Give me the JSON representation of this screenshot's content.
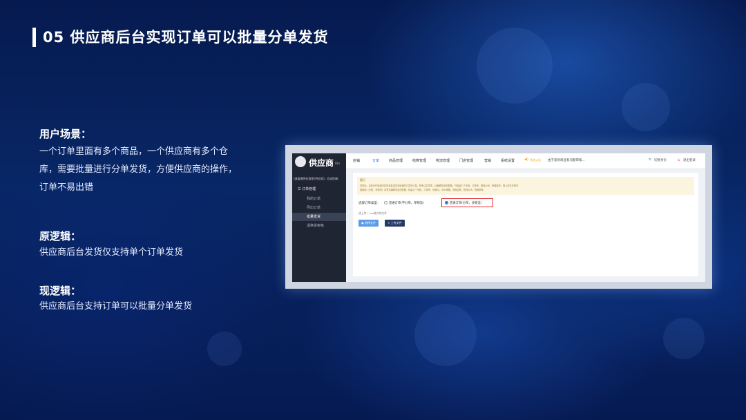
{
  "header": {
    "title": "05 供应商后台实现订单可以批量分单发货"
  },
  "sections": [
    {
      "title": "用户场景：",
      "text": "一个订单里面有多个商品，一个供应商有多个仓库，需要批量进行分单发货，方便供应商的操作，订单不易出错"
    },
    {
      "title": "原逻辑：",
      "text": "供应商后台发货仅支持单个订单发货"
    },
    {
      "title": "现逻辑：",
      "text": "供应商后台支持订单可以批量分单发货"
    }
  ],
  "screenshot": {
    "logo": {
      "text": "供应商",
      "sub": "Bbs"
    },
    "side_subtitle": "(逸盛通供应商家(供应商)，欢迎回来",
    "side_menu": "订单管理",
    "side_items": [
      "我的订单",
      "导出订单",
      "批量发货",
      "退换货审核"
    ],
    "nav": [
      "店铺",
      "订单",
      "商品管理",
      "结算管理",
      "物流管理",
      "门店管理",
      "营销",
      "系统设置"
    ],
    "notice_badge": "系统公告",
    "notice": "由于您的商品有问题审核...",
    "nav_right": [
      "切换身份",
      "退出登录"
    ],
    "tip_title": "提示",
    "tip_lines": [
      "发货后，请在ERP系统内将货品发送至本地城的订发货订单，所有注意事项，请编辑导出的表格，只保留三个字段，订单号，物流公司，快递单号，再上传文件即可",
      "若使用（分单、多物流）发货请编辑导出的表格，保留六个字段，订单号，商品ID，SKU规格，商品名称，物流公司，快递单号。"
    ],
    "option_label": "选择订单类型：",
    "option_1": "普通订单(不分单，单物流)",
    "option_2": "普通订单(分单，多物流)",
    "hint": "请上传 *.csv格式的文件",
    "btn_select": "选择文件",
    "btn_upload": "上传文件"
  }
}
